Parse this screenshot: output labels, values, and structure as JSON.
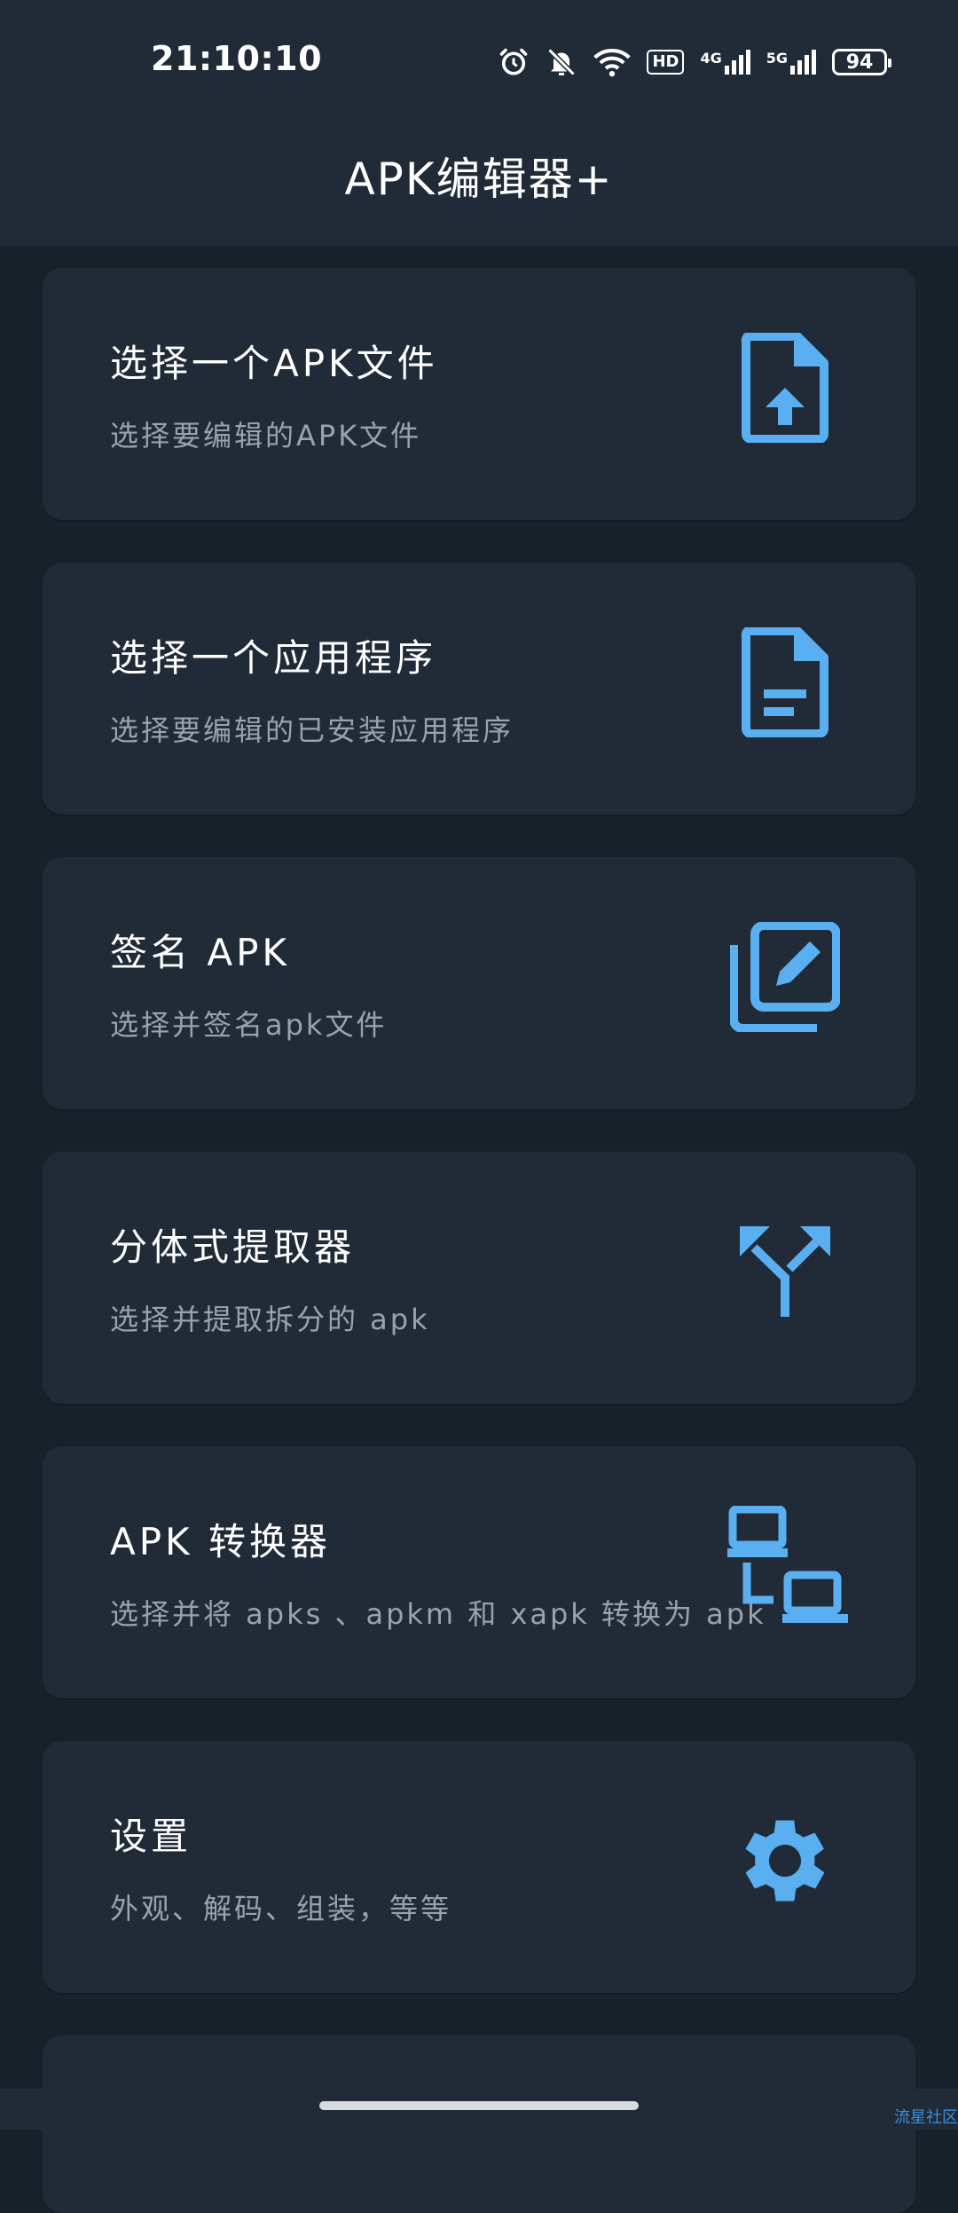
{
  "status_bar": {
    "time": "21:10:10",
    "icons": [
      "alarm-icon",
      "mute-icon",
      "wifi-icon",
      "hd-icon",
      "4g-signal-icon",
      "5g-signal-icon"
    ],
    "hd_label": "HD",
    "net1_label": "4G",
    "net2_label": "5G",
    "battery": "94"
  },
  "appbar": {
    "title": "APK编辑器+"
  },
  "accent_color": "#5aaff0",
  "cards": [
    {
      "title": "选择一个APK文件",
      "subtitle": "选择要编辑的APK文件",
      "icon": "file-upload-icon"
    },
    {
      "title": "选择一个应用程序",
      "subtitle": "选择要编辑的已安装应用程序",
      "icon": "document-icon"
    },
    {
      "title": "签名 APK",
      "subtitle": "选择并签名apk文件",
      "icon": "edit-copy-icon"
    },
    {
      "title": "分体式提取器",
      "subtitle": "选择并提取拆分的 apk",
      "icon": "split-arrows-icon"
    },
    {
      "title": "APK 转换器",
      "subtitle": "选择并将 apks 、apkm 和 xapk 转换为 apk",
      "icon": "convert-devices-icon"
    },
    {
      "title": "设置",
      "subtitle": "外观、解码、组装，等等",
      "icon": "gear-icon"
    }
  ],
  "watermark": "流星社区"
}
